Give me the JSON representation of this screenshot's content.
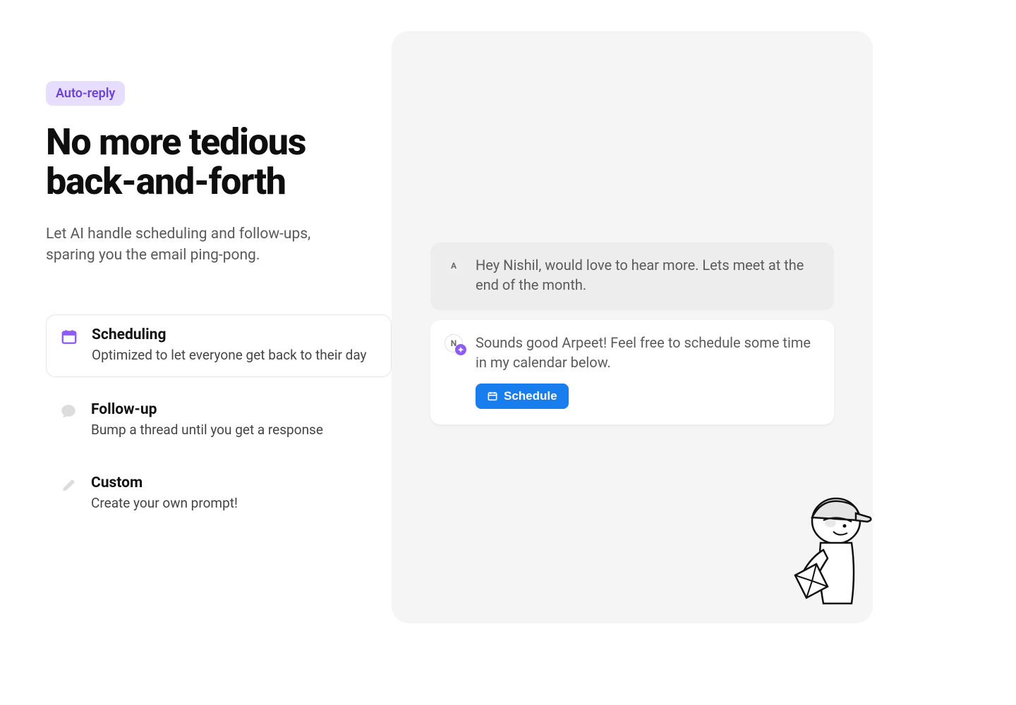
{
  "badge": "Auto-reply",
  "heading": "No more tedious back-and-forth",
  "subtext": "Let AI handle scheduling and follow-ups, sparing you the email ping-pong.",
  "features": {
    "scheduling": {
      "title": "Scheduling",
      "desc": "Optimized to let everyone get back to their day"
    },
    "followup": {
      "title": "Follow-up",
      "desc": "Bump a thread until you get a response"
    },
    "custom": {
      "title": "Custom",
      "desc": "Create your own prompt!"
    }
  },
  "chat": {
    "msg1": {
      "avatar": "A",
      "text": "Hey Nishil, would love to hear more. Lets meet at the end of the month."
    },
    "msg2": {
      "avatar": "N",
      "text": "Sounds good Arpeet! Feel free to schedule some time in my calendar below.",
      "button": "Schedule"
    }
  }
}
